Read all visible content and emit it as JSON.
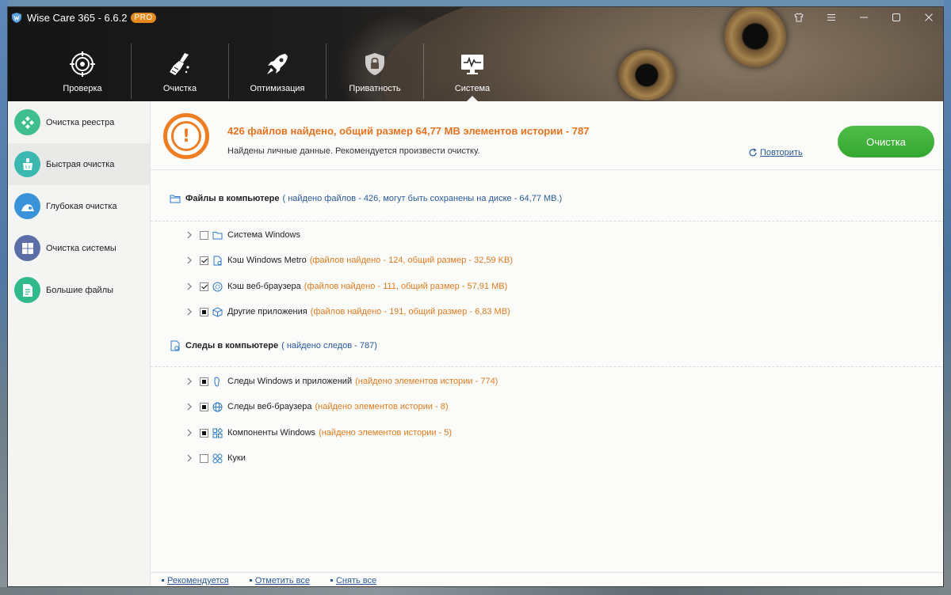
{
  "app": {
    "title": "Wise Care 365 - 6.6.2",
    "badge": "PRO"
  },
  "nav": [
    {
      "label": "Проверка",
      "icon": "target-icon"
    },
    {
      "label": "Очистка",
      "icon": "broom-icon"
    },
    {
      "label": "Оптимизация",
      "icon": "rocket-icon"
    },
    {
      "label": "Приватность",
      "icon": "shield-lock-icon"
    },
    {
      "label": "Система",
      "icon": "monitor-pulse-icon"
    }
  ],
  "sidebar": {
    "items": [
      {
        "label": "Очистка реестра",
        "icon": "registry-icon",
        "color": "#3fbf8f"
      },
      {
        "label": "Быстрая очистка",
        "icon": "quick-clean-icon",
        "color": "#3bb8b0"
      },
      {
        "label": "Глубокая очистка",
        "icon": "deep-clean-icon",
        "color": "#3a93d8"
      },
      {
        "label": "Очистка системы",
        "icon": "windows-icon",
        "color": "#5b6ea8"
      },
      {
        "label": "Большие файлы",
        "icon": "big-files-icon",
        "color": "#2fb98c"
      }
    ]
  },
  "summary": {
    "title": "426 файлов найдено, общий размер 64,77 MB элементов истории - 787",
    "subtitle": "Найдены личные данные. Рекомендуется произвести очистку.",
    "repeat_link": "Повторить",
    "clean_button": "Очистка"
  },
  "sections": {
    "files": {
      "title": "Файлы в компьютере",
      "detail": "( найдено файлов - 426, могут быть сохранены на диске - 64,77 MB.)",
      "rows": [
        {
          "label": "Система Windows",
          "detail": "",
          "state": "unchecked",
          "icon": "folder-icon"
        },
        {
          "label": "Кэш Windows Metro",
          "detail": "(файлов найдено - 124, общий размер - 32,59 KB)",
          "state": "checked",
          "icon": "metro-cache-icon"
        },
        {
          "label": "Кэш веб-браузера",
          "detail": "(файлов найдено - 111, общий размер - 57,91 MB)",
          "state": "checked",
          "icon": "browser-cache-icon"
        },
        {
          "label": "Другие приложения",
          "detail": "(файлов найдено - 191, общий размер - 6,83 MB)",
          "state": "partial",
          "icon": "cube-icon"
        }
      ]
    },
    "traces": {
      "title": "Следы в компьютере",
      "detail": "( найдено следов - 787)",
      "rows": [
        {
          "label": "Следы Windows и приложений",
          "detail": "(найдено элементов истории - 774)",
          "state": "partial",
          "icon": "footprint-icon"
        },
        {
          "label": "Следы веб-браузера",
          "detail": "(найдено элементов истории - 8)",
          "state": "partial",
          "icon": "globe-icon"
        },
        {
          "label": "Компоненты Windows",
          "detail": "(найдено элементов истории - 5)",
          "state": "partial",
          "icon": "windows-components-icon"
        },
        {
          "label": "Куки",
          "detail": "",
          "state": "unchecked",
          "icon": "cookie-icon"
        }
      ]
    }
  },
  "footer": {
    "recommended": "Рекомендуется",
    "check_all": "Отметить все",
    "uncheck_all": "Снять все"
  },
  "colors": {
    "accent_orange": "#ef7d22",
    "clean_green": "#3bb037",
    "link_blue": "#2a5a9a"
  }
}
